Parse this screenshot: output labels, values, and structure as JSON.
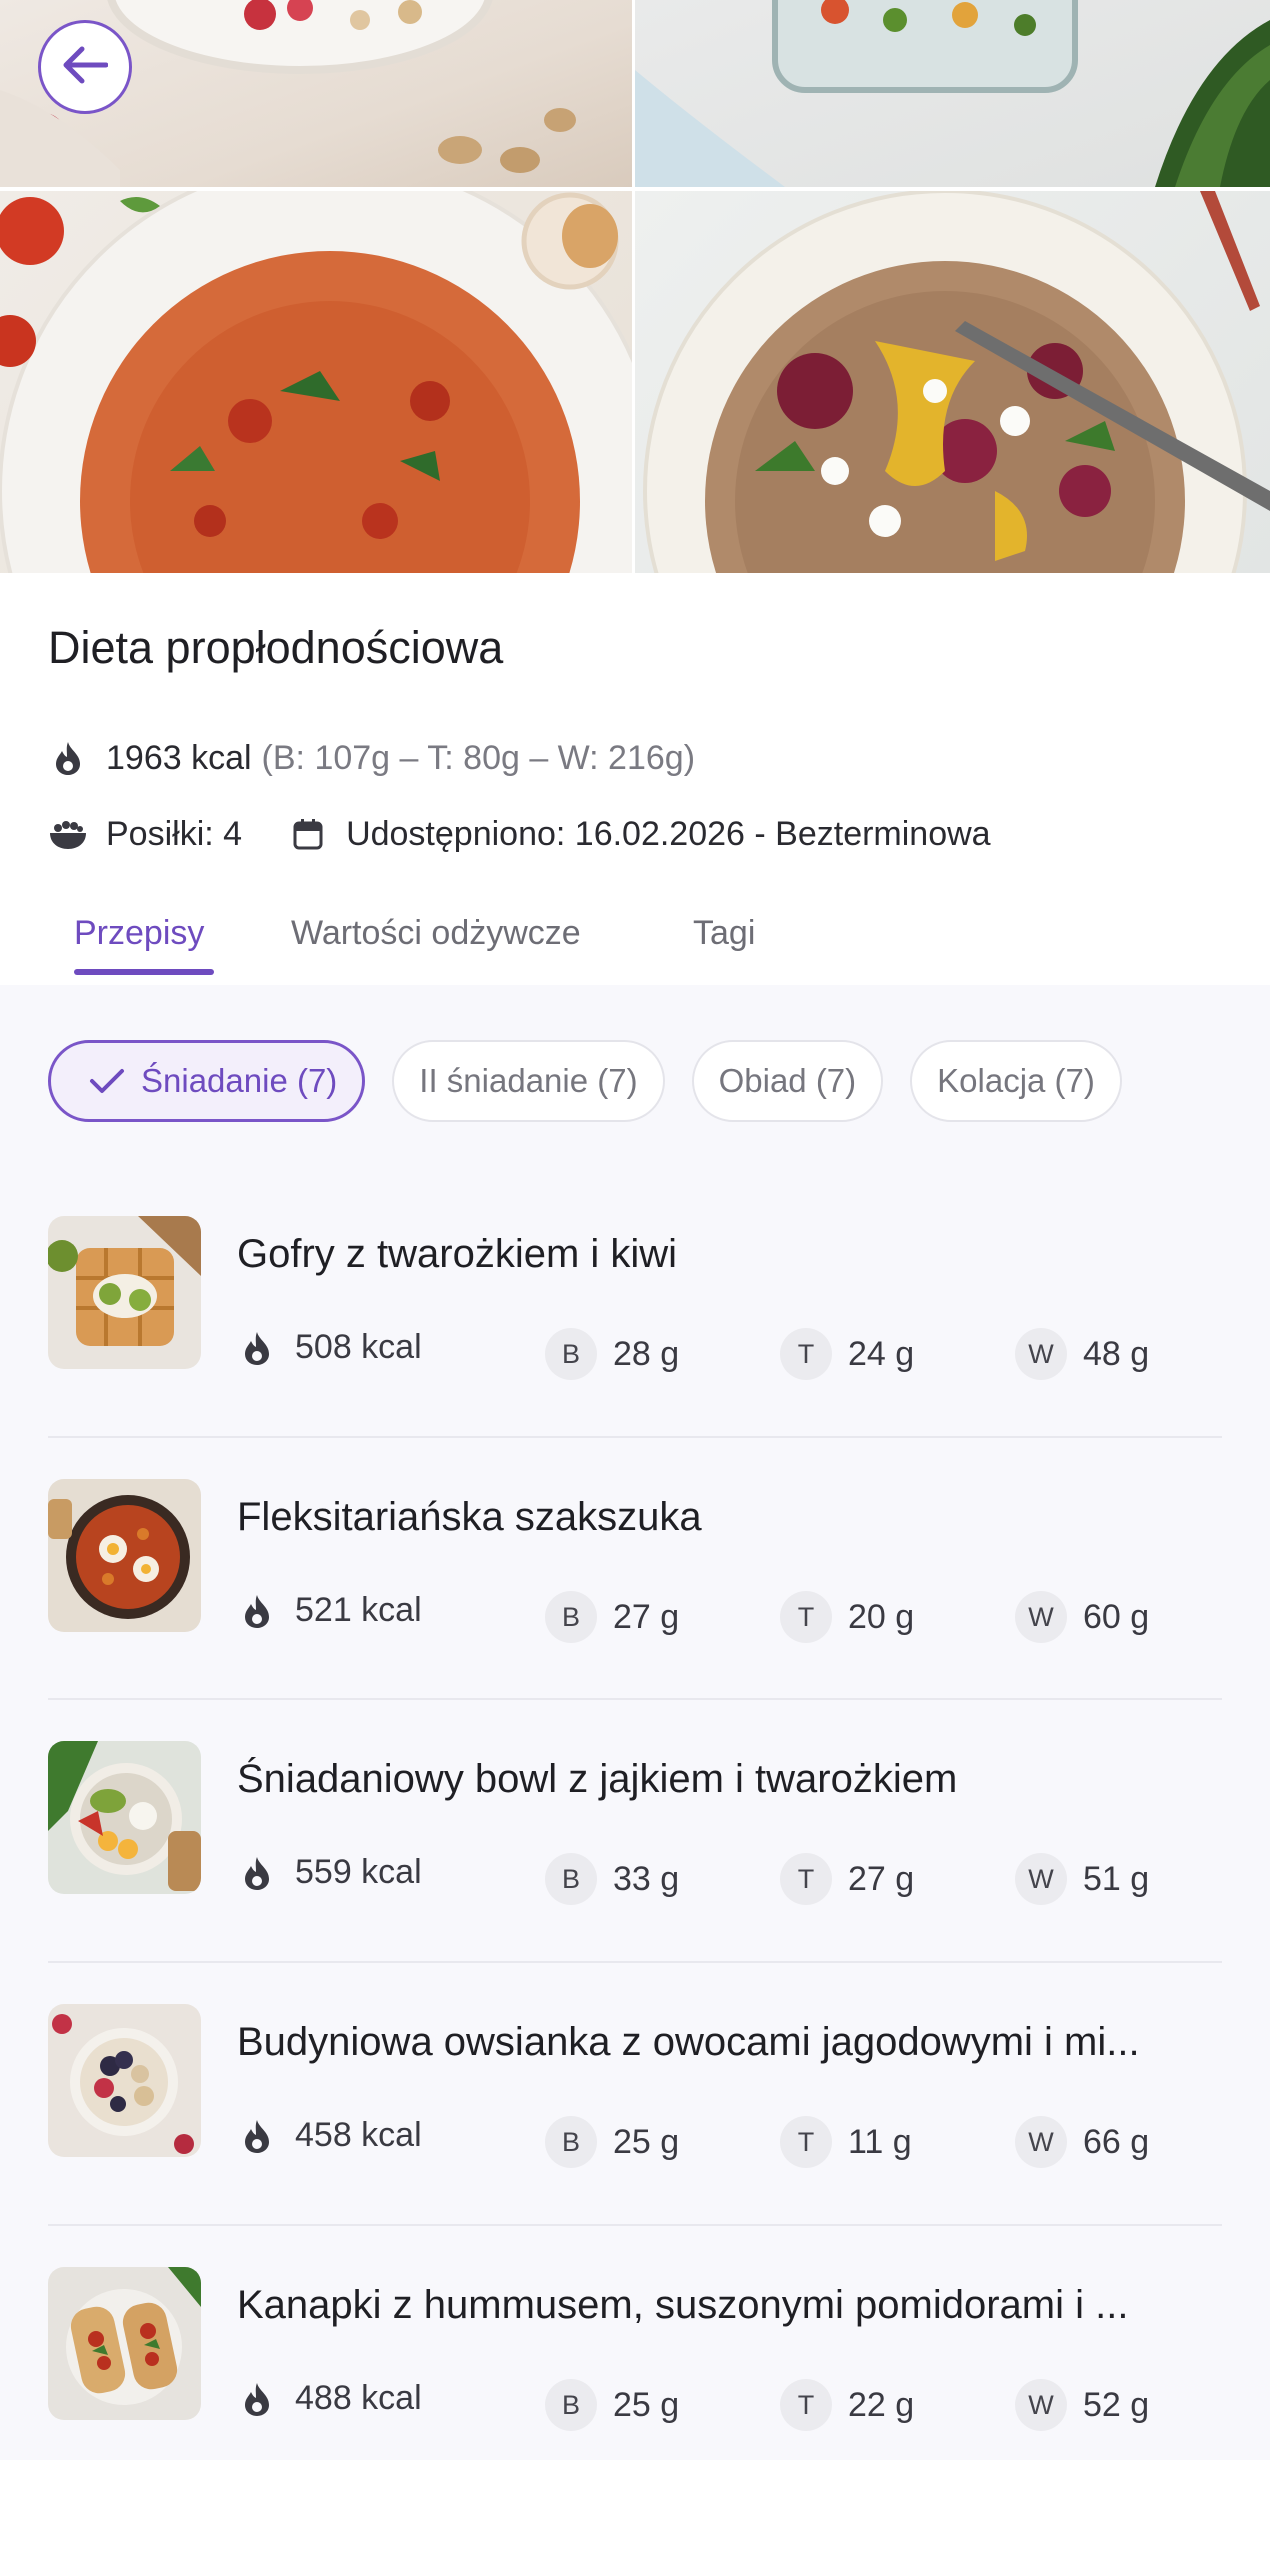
{
  "header": {
    "title": "Dieta propłodnościowa",
    "kcal": "1963 kcal",
    "macros": "(B: 107g – T: 80g – W: 216g)",
    "meals": "Posiłki: 4",
    "shared": "Udostępniono: 16.02.2026 - Bezterminowa"
  },
  "tabs": [
    {
      "label": "Przepisy",
      "active": true
    },
    {
      "label": "Wartości odżywcze",
      "active": false
    },
    {
      "label": "Tagi",
      "active": false
    }
  ],
  "chips": [
    {
      "label": "Śniadanie (7)",
      "active": true
    },
    {
      "label": "II śniadanie (7)",
      "active": false
    },
    {
      "label": "Obiad (7)",
      "active": false
    },
    {
      "label": "Kolacja (7)",
      "active": false
    }
  ],
  "macro_labels": {
    "b": "B",
    "t": "T",
    "w": "W"
  },
  "recipes": [
    {
      "name": "Gofry z twarożkiem i kiwi",
      "kcal": "508 kcal",
      "b": "28 g",
      "t": "24 g",
      "w": "48 g"
    },
    {
      "name": "Fleksitariańska szakszuka",
      "kcal": "521 kcal",
      "b": "27 g",
      "t": "20 g",
      "w": "60 g"
    },
    {
      "name": "Śniadaniowy bowl z jajkiem i twarożkiem",
      "kcal": "559 kcal",
      "b": "33 g",
      "t": "27 g",
      "w": "51 g"
    },
    {
      "name": "Budyniowa owsianka z owocami jagodowymi i mi...",
      "kcal": "458 kcal",
      "b": "25 g",
      "t": "11 g",
      "w": "66 g"
    },
    {
      "name": "Kanapki z hummusem, suszonymi pomidorami i ...",
      "kcal": "488 kcal",
      "b": "25 g",
      "t": "22 g",
      "w": "52 g"
    }
  ],
  "colors": {
    "accent": "#6e4bbf",
    "background": "#f8f8fc"
  },
  "icons": [
    "back-arrow-icon",
    "flame-icon",
    "bowl-icon",
    "calendar-icon",
    "check-icon"
  ]
}
